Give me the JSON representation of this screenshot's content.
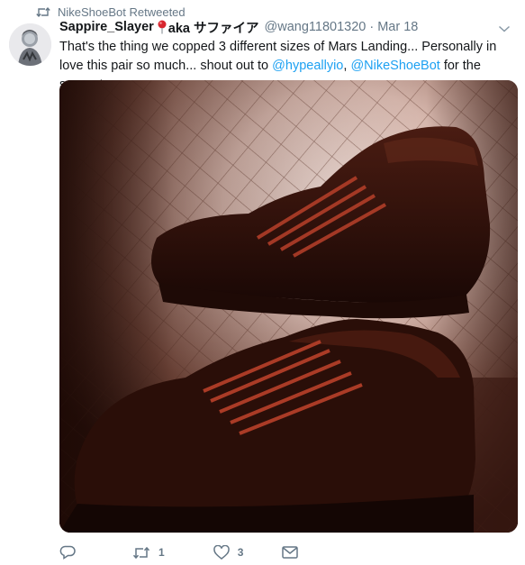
{
  "retweet_context": {
    "label": "NikeShoeBot Retweeted"
  },
  "tweet": {
    "author_name": "Sappire_Slayer",
    "author_suffix": "aka サファイア",
    "handle": "@wang11801320",
    "separator": "·",
    "timestamp": "Mar 18",
    "text_part1": "That's the thing we copped 3 different sizes of Mars Landing... Personally in love this pair so much... shout out to ",
    "mention1": "@hypeallyio",
    "text_part2": ", ",
    "mention2": "@NikeShoeBot",
    "text_part3": " for the support.",
    "media_icon": "photo-of-sneakers"
  },
  "actions": {
    "reply_count": "",
    "retweet_count": "1",
    "like_count": "3",
    "icons": [
      "reply-icon",
      "retweet-icon",
      "like-icon",
      "dm-icon"
    ]
  },
  "colors": {
    "link": "#1da1f2",
    "muted": "#657786",
    "text": "#14171a"
  }
}
